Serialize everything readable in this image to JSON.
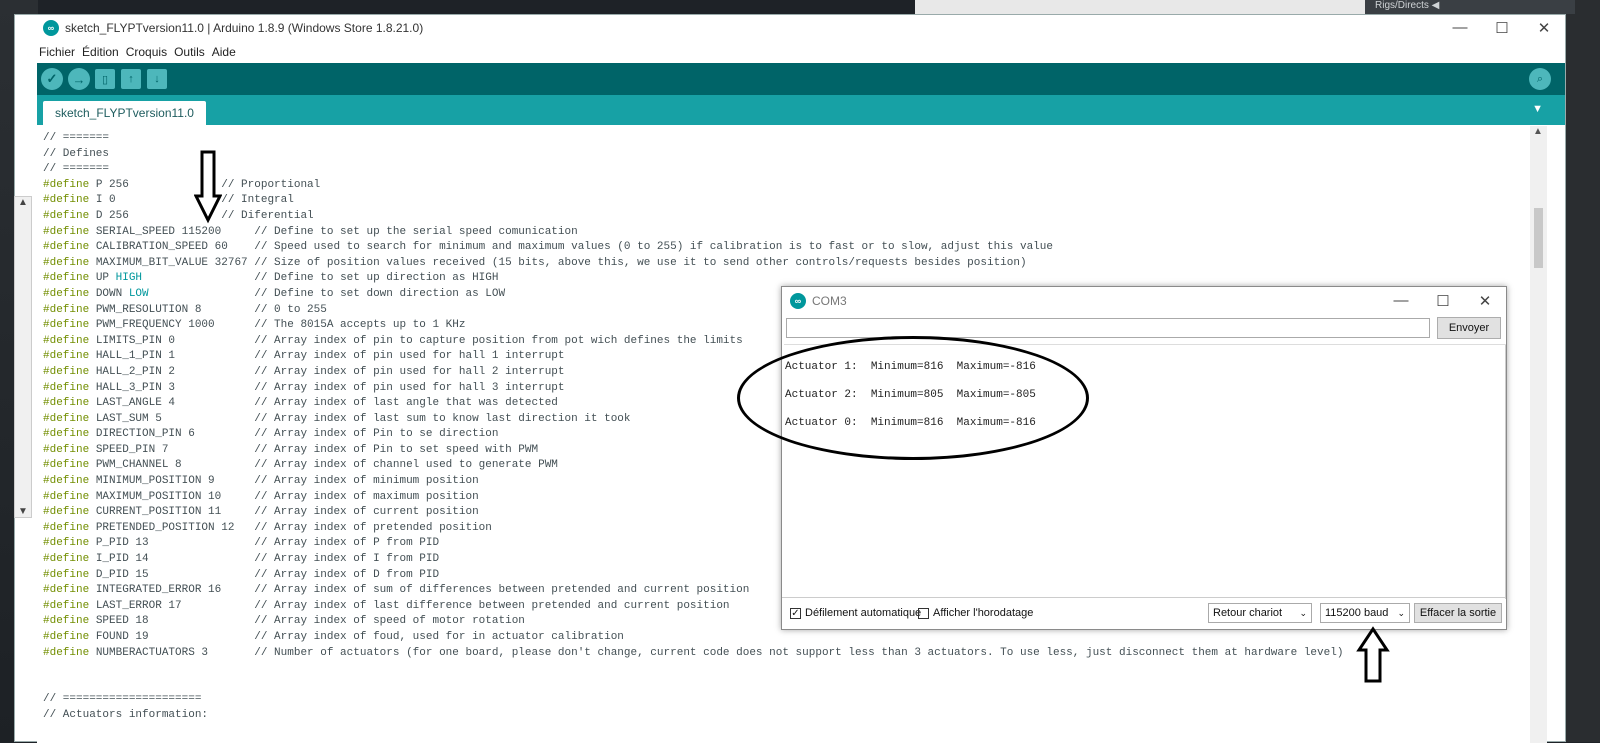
{
  "window": {
    "title": "sketch_FLYPTversion11.0 | Arduino 1.8.9 (Windows Store 1.8.21.0)",
    "controls": [
      "—",
      "☐",
      "✕"
    ]
  },
  "background": {
    "label": "Rigs/Directs ◀"
  },
  "menu": [
    "Fichier",
    "Édition",
    "Croquis",
    "Outils",
    "Aide"
  ],
  "tab": {
    "label": "sketch_FLYPTversion11.0"
  },
  "code_lines": [
    [
      {
        "t": "// ======="
      }
    ],
    [
      {
        "t": "// Defines"
      }
    ],
    [
      {
        "t": "// ======="
      }
    ],
    [
      {
        "t": "#define",
        "c": "kw"
      },
      {
        "t": " P 256              // Proportional"
      }
    ],
    [
      {
        "t": "#define",
        "c": "kw"
      },
      {
        "t": " I 0                // Integral"
      }
    ],
    [
      {
        "t": "#define",
        "c": "kw"
      },
      {
        "t": " D 256              // Diferential"
      }
    ],
    [
      {
        "t": "#define",
        "c": "kw"
      },
      {
        "t": " SERIAL_SPEED 115200     // Define to set up the serial speed comunication"
      }
    ],
    [
      {
        "t": "#define",
        "c": "kw"
      },
      {
        "t": " CALIBRATION_SPEED 60    // Speed used to search for minimum and maximum values (0 to 255) if calibration is to fast or to slow, adjust this value"
      }
    ],
    [
      {
        "t": "#define",
        "c": "kw"
      },
      {
        "t": " MAXIMUM_BIT_VALUE 32767 // Size of position values received (15 bits, above this, we use it to send other controls/requests besides position)"
      }
    ],
    [
      {
        "t": "#define",
        "c": "kw"
      },
      {
        "t": " UP "
      },
      {
        "t": "HIGH",
        "c": "const"
      },
      {
        "t": "                 // Define to set up direction as HIGH"
      }
    ],
    [
      {
        "t": "#define",
        "c": "kw"
      },
      {
        "t": " DOWN "
      },
      {
        "t": "LOW",
        "c": "const"
      },
      {
        "t": "                // Define to set down direction as LOW"
      }
    ],
    [
      {
        "t": "#define",
        "c": "kw"
      },
      {
        "t": " PWM_RESOLUTION 8        // 0 to 255"
      }
    ],
    [
      {
        "t": "#define",
        "c": "kw"
      },
      {
        "t": " PWM_FREQUENCY 1000      // The 8015A accepts up to 1 KHz"
      }
    ],
    [
      {
        "t": "#define",
        "c": "kw"
      },
      {
        "t": " LIMITS_PIN 0            // Array index of pin to capture position from pot wich defines the limits"
      }
    ],
    [
      {
        "t": "#define",
        "c": "kw"
      },
      {
        "t": " HALL_1_PIN 1            // Array index of pin used for hall 1 interrupt"
      }
    ],
    [
      {
        "t": "#define",
        "c": "kw"
      },
      {
        "t": " HALL_2_PIN 2            // Array index of pin used for hall 2 interrupt"
      }
    ],
    [
      {
        "t": "#define",
        "c": "kw"
      },
      {
        "t": " HALL_3_PIN 3            // Array index of pin used for hall 3 interrupt"
      }
    ],
    [
      {
        "t": "#define",
        "c": "kw"
      },
      {
        "t": " LAST_ANGLE 4            // Array index of last angle that was detected"
      }
    ],
    [
      {
        "t": "#define",
        "c": "kw"
      },
      {
        "t": " LAST_SUM 5              // Array index of last sum to know last direction it took"
      }
    ],
    [
      {
        "t": "#define",
        "c": "kw"
      },
      {
        "t": " DIRECTION_PIN 6         // Array index of Pin to se direction"
      }
    ],
    [
      {
        "t": "#define",
        "c": "kw"
      },
      {
        "t": " SPEED_PIN 7             // Array index of Pin to set speed with PWM"
      }
    ],
    [
      {
        "t": "#define",
        "c": "kw"
      },
      {
        "t": " PWM_CHANNEL 8           // Array index of channel used to generate PWM"
      }
    ],
    [
      {
        "t": "#define",
        "c": "kw"
      },
      {
        "t": " MINIMUM_POSITION 9      // Array index of minimum position"
      }
    ],
    [
      {
        "t": "#define",
        "c": "kw"
      },
      {
        "t": " MAXIMUM_POSITION 10     // Array index of maximum position"
      }
    ],
    [
      {
        "t": "#define",
        "c": "kw"
      },
      {
        "t": " CURRENT_POSITION 11     // Array index of current position"
      }
    ],
    [
      {
        "t": "#define",
        "c": "kw"
      },
      {
        "t": " PRETENDED_POSITION 12   // Array index of pretended position"
      }
    ],
    [
      {
        "t": "#define",
        "c": "kw"
      },
      {
        "t": " P_PID 13                // Array index of P from PID"
      }
    ],
    [
      {
        "t": "#define",
        "c": "kw"
      },
      {
        "t": " I_PID 14                // Array index of I from PID"
      }
    ],
    [
      {
        "t": "#define",
        "c": "kw"
      },
      {
        "t": " D_PID 15                // Array index of D from PID"
      }
    ],
    [
      {
        "t": "#define",
        "c": "kw"
      },
      {
        "t": " INTEGRATED_ERROR 16     // Array index of sum of differences between pretended and current position"
      }
    ],
    [
      {
        "t": "#define",
        "c": "kw"
      },
      {
        "t": " LAST_ERROR 17           // Array index of last difference between pretended and current position"
      }
    ],
    [
      {
        "t": "#define",
        "c": "kw"
      },
      {
        "t": " SPEED 18                // Array index of speed of motor rotation"
      }
    ],
    [
      {
        "t": "#define",
        "c": "kw"
      },
      {
        "t": " FOUND 19                // Array index of foud, used for in actuator calibration"
      }
    ],
    [
      {
        "t": "#define",
        "c": "kw"
      },
      {
        "t": " NUMBERACTUATORS 3       // Number of actuators (for one board, please don't change, current code does not support less than 3 actuators. To use less, just disconnect them at hardware level)"
      }
    ],
    [
      {
        "t": ""
      }
    ],
    [
      {
        "t": ""
      }
    ],
    [
      {
        "t": "// ====================="
      }
    ],
    [
      {
        "t": "// Actuators information:"
      }
    ]
  ],
  "serial_monitor": {
    "title": "COM3",
    "send_label": "Envoyer",
    "input_value": "",
    "output_lines": [
      "Actuator 1:  Minimum=816  Maximum=-816",
      "Actuator 2:  Minimum=805  Maximum=-805",
      "Actuator 0:  Minimum=816  Maximum=-816"
    ],
    "autoscroll_label": "Défilement automatique",
    "autoscroll_checked": true,
    "timestamp_label": "Afficher l'horodatage",
    "timestamp_checked": false,
    "line_ending": "Retour chariot",
    "baud": "115200  baud",
    "clear_label": "Effacer la sortie"
  }
}
